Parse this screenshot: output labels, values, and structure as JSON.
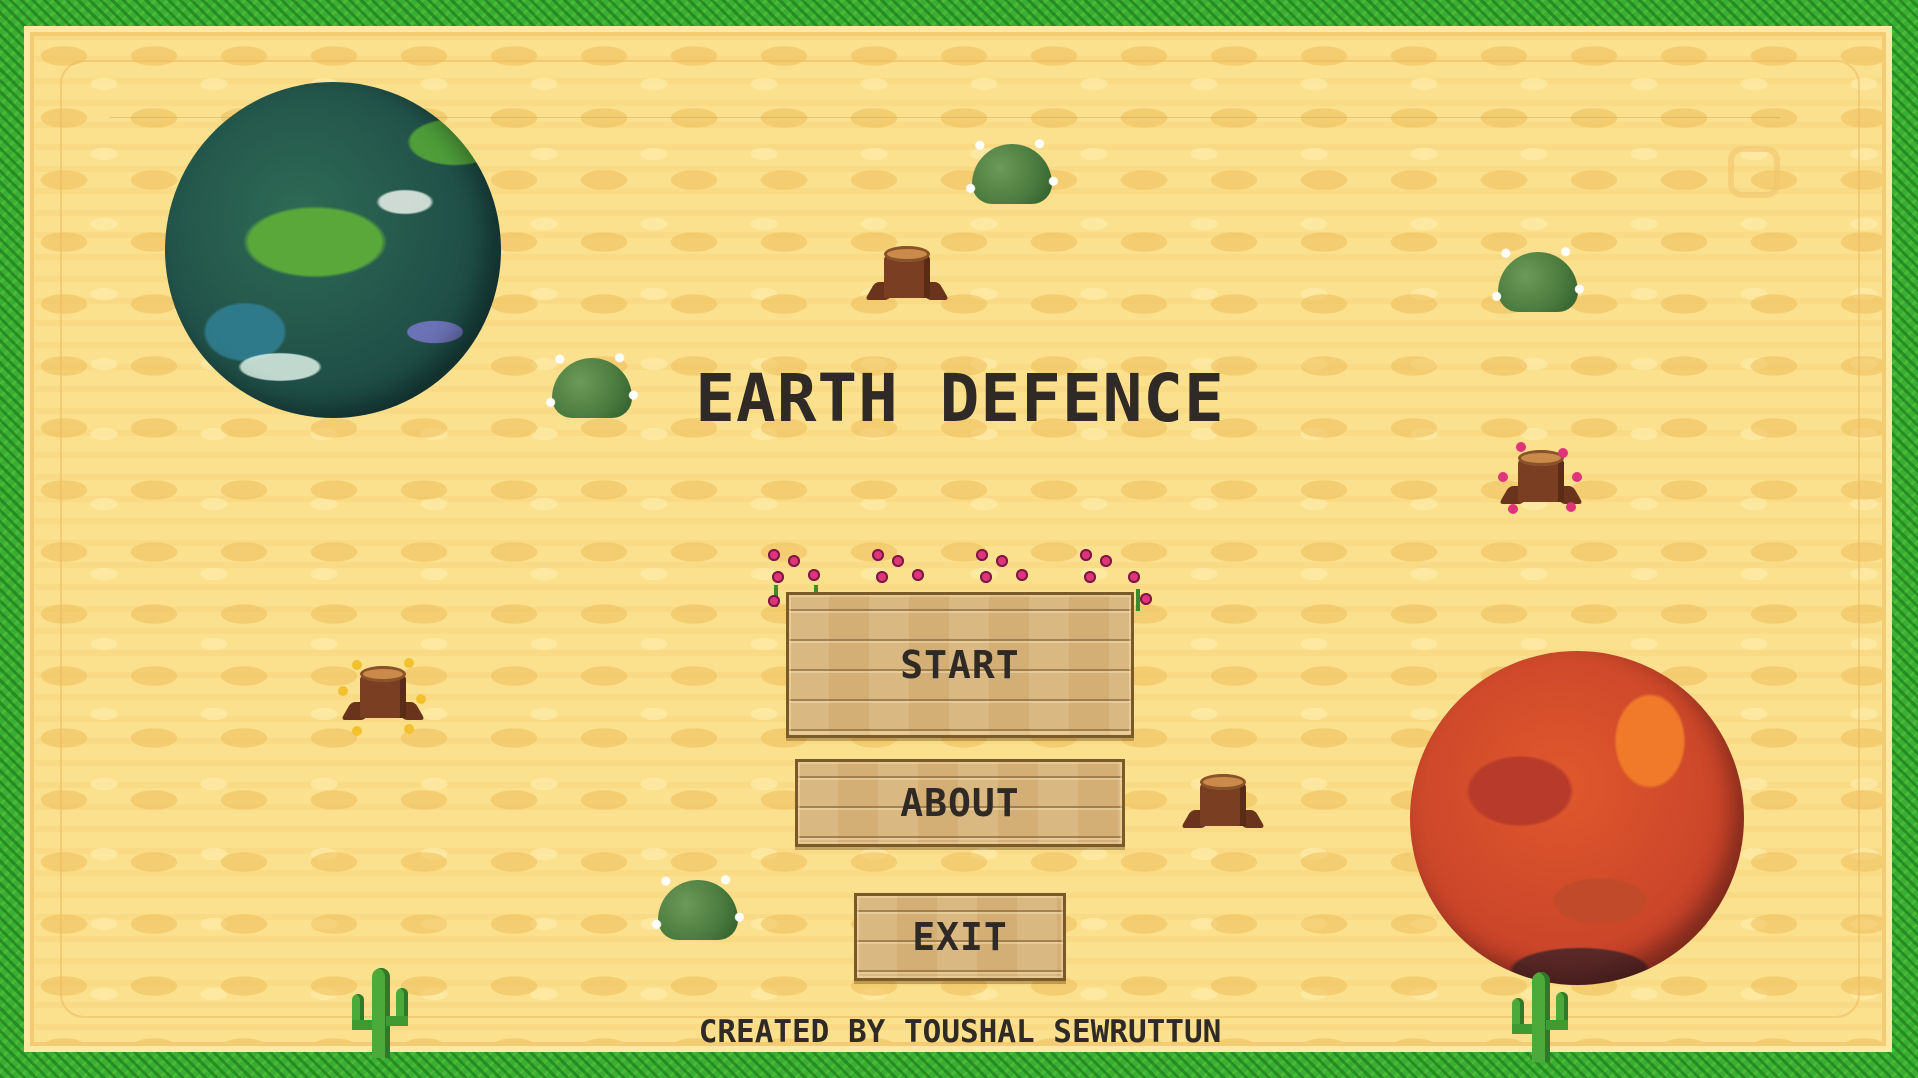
{
  "game": {
    "title": "EARTH DEFENCE",
    "credit": "CREATED BY TOUSHAL SEWRUTTUN"
  },
  "menu": {
    "start_label": "START",
    "about_label": "ABOUT",
    "exit_label": "EXIT"
  },
  "colors": {
    "sand": "#fbe08e",
    "grass_border": "#3aae32",
    "text": "#2f2a26",
    "plank": "#d8b47a",
    "flower_pink": "#e0347a",
    "flower_yellow": "#f2c12e"
  },
  "icons": {
    "planets": [
      "earth-planet",
      "mars-planet"
    ],
    "decorations": [
      "bush-icon",
      "tree-stump-icon",
      "flowered-stump-icon",
      "cactus-icon",
      "flower-icon"
    ]
  }
}
